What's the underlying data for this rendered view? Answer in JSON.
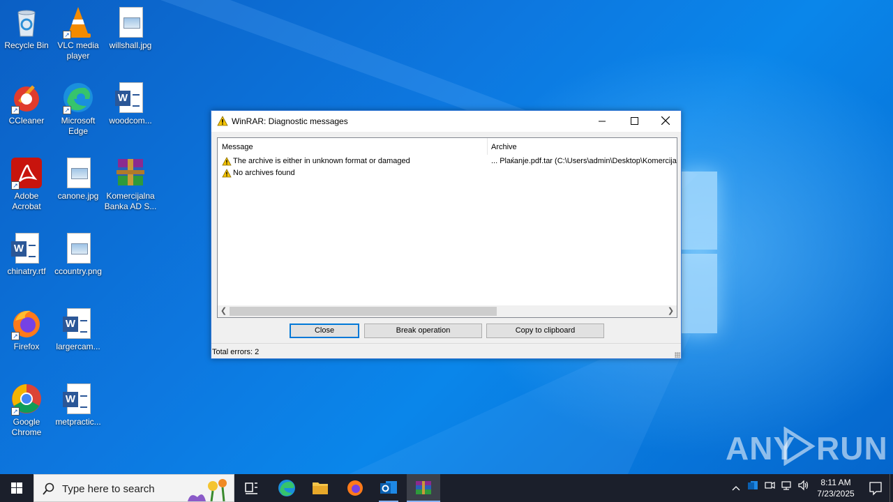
{
  "desktop": {
    "icons": [
      {
        "label": "Recycle Bin",
        "icon": "recycle-bin-icon"
      },
      {
        "label": "VLC media player",
        "icon": "vlc-icon"
      },
      {
        "label": "willshall.jpg",
        "icon": "image-file-icon"
      },
      {
        "label": "CCleaner",
        "icon": "ccleaner-icon"
      },
      {
        "label": "Microsoft Edge",
        "icon": "edge-icon"
      },
      {
        "label": "woodcom...",
        "icon": "word-doc-icon"
      },
      {
        "label": "Adobe Acrobat",
        "icon": "acrobat-icon"
      },
      {
        "label": "canone.jpg",
        "icon": "image-file-icon"
      },
      {
        "label": "Komercijalna Banka AD S...",
        "icon": "winrar-archive-icon"
      },
      {
        "label": "chinatry.rtf",
        "icon": "word-doc-icon"
      },
      {
        "label": "ccountry.png",
        "icon": "image-file-icon"
      },
      {
        "label": "Firefox",
        "icon": "firefox-icon"
      },
      {
        "label": "largercam...",
        "icon": "word-doc-icon"
      },
      {
        "label": "Google Chrome",
        "icon": "chrome-icon"
      },
      {
        "label": "metpractic...",
        "icon": "word-doc-icon"
      }
    ]
  },
  "dialog": {
    "title": "WinRAR: Diagnostic messages",
    "columns": {
      "message": "Message",
      "archive": "Archive"
    },
    "rows": [
      {
        "message": "The archive is either in unknown format or damaged",
        "archive": "... Plaќanje.pdf.tar (C:\\Users\\admin\\Desktop\\Komercija"
      },
      {
        "message": "No archives found",
        "archive": ""
      }
    ],
    "buttons": {
      "close": "Close",
      "break": "Break operation",
      "copy": "Copy to clipboard"
    },
    "status": "Total errors: 2"
  },
  "watermark": {
    "left": "ANY",
    "right": "RUN"
  },
  "taskbar": {
    "search_placeholder": "Type here to search",
    "time": "8:11 AM",
    "date": "7/23/2025"
  },
  "colors": {
    "accent": "#0078d7",
    "warning": "#f5c400"
  }
}
